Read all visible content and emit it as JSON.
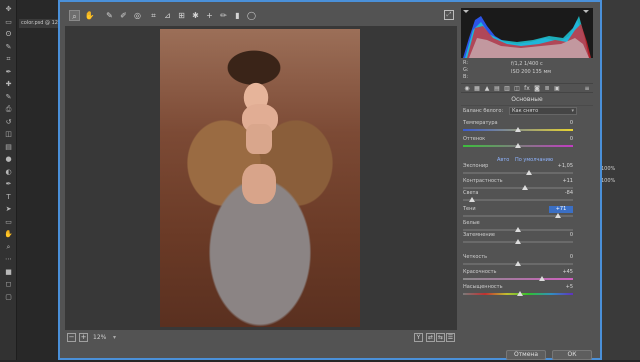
{
  "photoshop": {
    "doc_tab": "color.psd @ 12",
    "tools": [
      "move-icon",
      "marquee-icon",
      "lasso-icon",
      "quick-select-icon",
      "crop-icon",
      "eyedropper-icon",
      "healing-icon",
      "brush-icon",
      "stamp-icon",
      "history-icon",
      "eraser-icon",
      "gradient-icon",
      "blur-icon",
      "dodge-icon",
      "pen-icon",
      "type-icon",
      "path-select-icon",
      "shape-icon",
      "hand-icon",
      "zoom-icon",
      "more-icon",
      "colors-icon",
      "mask-icon",
      "screen-mode-icon"
    ],
    "right_panel": {
      "pct1": "100%",
      "pct2": "100%"
    }
  },
  "acr": {
    "zoom": {
      "minus": "−",
      "level": "12%",
      "caret": "▾",
      "plus": "+"
    },
    "footer": {
      "cancel": "Отмена",
      "ok": "ОК"
    },
    "meta": {
      "r": "R:",
      "g": "G:",
      "b": "B:",
      "aperture_shutter": "f/1,2   1/400 с",
      "iso_focal": "ISO 200   135 мм"
    },
    "panel_title": "Основные",
    "white_balance": {
      "label": "Баланс белого:",
      "value": "Как снято"
    },
    "links": {
      "auto": "Авто",
      "default": "По умолчанию"
    },
    "sliders": [
      {
        "label": "Температура",
        "value": "0",
        "frac": 0.5,
        "track": "temp"
      },
      {
        "label": "Оттенок",
        "value": "0",
        "frac": 0.5,
        "track": "tint"
      },
      {
        "label": "Экспонир",
        "value": "+1,05",
        "frac": 0.6,
        "track": "plain"
      },
      {
        "label": "Контрастность",
        "value": "+11",
        "frac": 0.56,
        "track": "plain"
      },
      {
        "label": "Света",
        "value": "-84",
        "frac": 0.08,
        "track": "plain"
      },
      {
        "label": "Тени",
        "value": "+71",
        "frac": 0.86,
        "track": "plain",
        "highlight": true
      },
      {
        "label": "Белые",
        "value": "",
        "frac": 0.5,
        "track": "plain"
      },
      {
        "label": "Затемнение",
        "value": "0",
        "frac": 0.5,
        "track": "plain"
      },
      {
        "label": "Четкость",
        "value": "0",
        "frac": 0.5,
        "track": "plain"
      },
      {
        "label": "Красочность",
        "value": "+45",
        "frac": 0.72,
        "track": "vib"
      },
      {
        "label": "Насыщенность",
        "value": "+5",
        "frac": 0.52,
        "track": "sat"
      }
    ]
  }
}
